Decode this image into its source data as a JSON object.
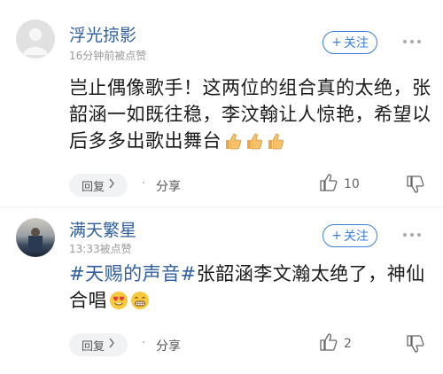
{
  "comments": [
    {
      "username": "浮光掠影",
      "meta": "16分钟前被点赞",
      "follow_label": "关注",
      "text_main": "岂止偶像歌手！这两位的组合真的太绝，张韶涵一如既往稳，李汶翰让人惊艳，希望以后多多出歌出舞台",
      "emojis": [
        "thumbs-up",
        "thumbs-up",
        "thumbs-up"
      ],
      "reply_label": "回复",
      "share_label": "分享",
      "like_count": "10"
    },
    {
      "username": "满天繁星",
      "meta": "13:33被点赞",
      "follow_label": "关注",
      "hashtag1": "#天赐的声音#",
      "text_rest": "张韶涵李文瀚太绝了，神仙合唱",
      "emojis": [
        "heart-eyes",
        "grin"
      ],
      "reply_label": "回复",
      "share_label": "分享",
      "like_count": "2"
    }
  ],
  "colors": {
    "accent": "#3b7fd6",
    "username": "#2f5f9e",
    "meta": "#999999"
  }
}
